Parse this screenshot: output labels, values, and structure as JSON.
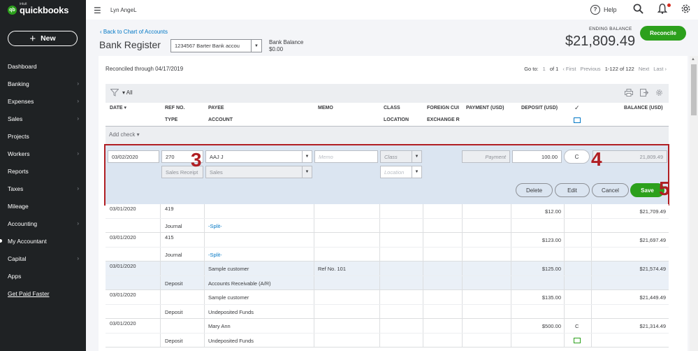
{
  "app": {
    "logo_intuit": "intuit",
    "logo_name": "quickbooks",
    "new_label": "New",
    "company": "Lyn AngeL",
    "help_label": "Help",
    "brand_color": "#2ca01c"
  },
  "sidebar": {
    "items": [
      {
        "label": "Dashboard",
        "chevron": ""
      },
      {
        "label": "Banking",
        "chevron": "›"
      },
      {
        "label": "Expenses",
        "chevron": "›"
      },
      {
        "label": "Sales",
        "chevron": "›"
      },
      {
        "label": "Projects",
        "chevron": ""
      },
      {
        "label": "Workers",
        "chevron": "›"
      },
      {
        "label": "Reports",
        "chevron": ""
      },
      {
        "label": "Taxes",
        "chevron": "›"
      },
      {
        "label": "Mileage",
        "chevron": ""
      },
      {
        "label": "Accounting",
        "chevron": "›"
      },
      {
        "label": "My Accountant",
        "chevron": ""
      },
      {
        "label": "Capital",
        "chevron": "›"
      },
      {
        "label": "Apps",
        "chevron": ""
      },
      {
        "label": "Get Paid Faster",
        "chevron": ""
      }
    ]
  },
  "header": {
    "back_link": "Back to Chart of Accounts",
    "title": "Bank Register",
    "account": "1234567 Barter Bank accou",
    "bank_balance_label": "Bank Balance",
    "bank_balance_value": "$0.00",
    "ending_balance_label": "ENDING BALANCE",
    "ending_balance_value": "$21,809.49",
    "reconcile_label": "Reconcile"
  },
  "toolbar": {
    "reconciled_through": "Reconciled through 04/17/2019",
    "goto_label": "Go to:",
    "goto_page": "1",
    "of_pages": "of 1",
    "first": "‹ First",
    "previous": "Previous",
    "range": "1-122 of 122",
    "next": "Next",
    "last": "Last ›",
    "filter_all": "All"
  },
  "columns": {
    "date": "DATE ▾",
    "ref_no": "REF NO.",
    "type": "TYPE",
    "payee": "PAYEE",
    "account": "ACCOUNT",
    "memo": "MEMO",
    "class": "CLASS",
    "location": "LOCATION",
    "foreign_cur": "FOREIGN CUI",
    "exchange_r": "EXCHANGE R",
    "payment": "PAYMENT (USD)",
    "deposit": "DEPOSIT (USD)",
    "check": "✓",
    "balance": "BALANCE (USD)"
  },
  "add_check": "Add check",
  "edit_row": {
    "date": "03/02/2020",
    "ref_no": "270",
    "payee": "AAJ J",
    "memo_placeholder": "Memo",
    "class_placeholder": "Class",
    "payment_placeholder": "Payment",
    "deposit": "100.00",
    "cleared": "C",
    "balance": "21,809.49",
    "type": "Sales Receipt",
    "account": "Sales",
    "location_placeholder": "Location",
    "delete_label": "Delete",
    "edit_label": "Edit",
    "cancel_label": "Cancel",
    "save_label": "Save"
  },
  "rows": [
    {
      "date": "03/01/2020",
      "ref": "419",
      "type": "Journal",
      "payee": "",
      "account": "-Split-",
      "memo": "",
      "deposit": "$12.00",
      "cleared": "",
      "balance": "$21,709.49"
    },
    {
      "date": "03/01/2020",
      "ref": "415",
      "type": "Journal",
      "payee": "",
      "account": "-Split-",
      "memo": "",
      "deposit": "$123.00",
      "cleared": "",
      "balance": "$21,697.49"
    },
    {
      "date": "03/01/2020",
      "ref": "",
      "type": "Deposit",
      "payee": "Sample customer",
      "account": "Accounts Receivable (A/R)",
      "memo": "Ref No. 101",
      "deposit": "$125.00",
      "cleared": "",
      "balance": "$21,574.49"
    },
    {
      "date": "03/01/2020",
      "ref": "",
      "type": "Deposit",
      "payee": "Sample customer",
      "account": "Undeposited Funds",
      "memo": "",
      "deposit": "$135.00",
      "cleared": "",
      "balance": "$21,449.49"
    },
    {
      "date": "03/01/2020",
      "ref": "",
      "type": "Deposit",
      "payee": "Mary Ann",
      "account": "Undeposited Funds",
      "memo": "",
      "deposit": "$500.00",
      "cleared": "C",
      "balance": "$21,314.49"
    }
  ],
  "annotations": {
    "a3": "3",
    "a4": "4",
    "a5": "5"
  }
}
